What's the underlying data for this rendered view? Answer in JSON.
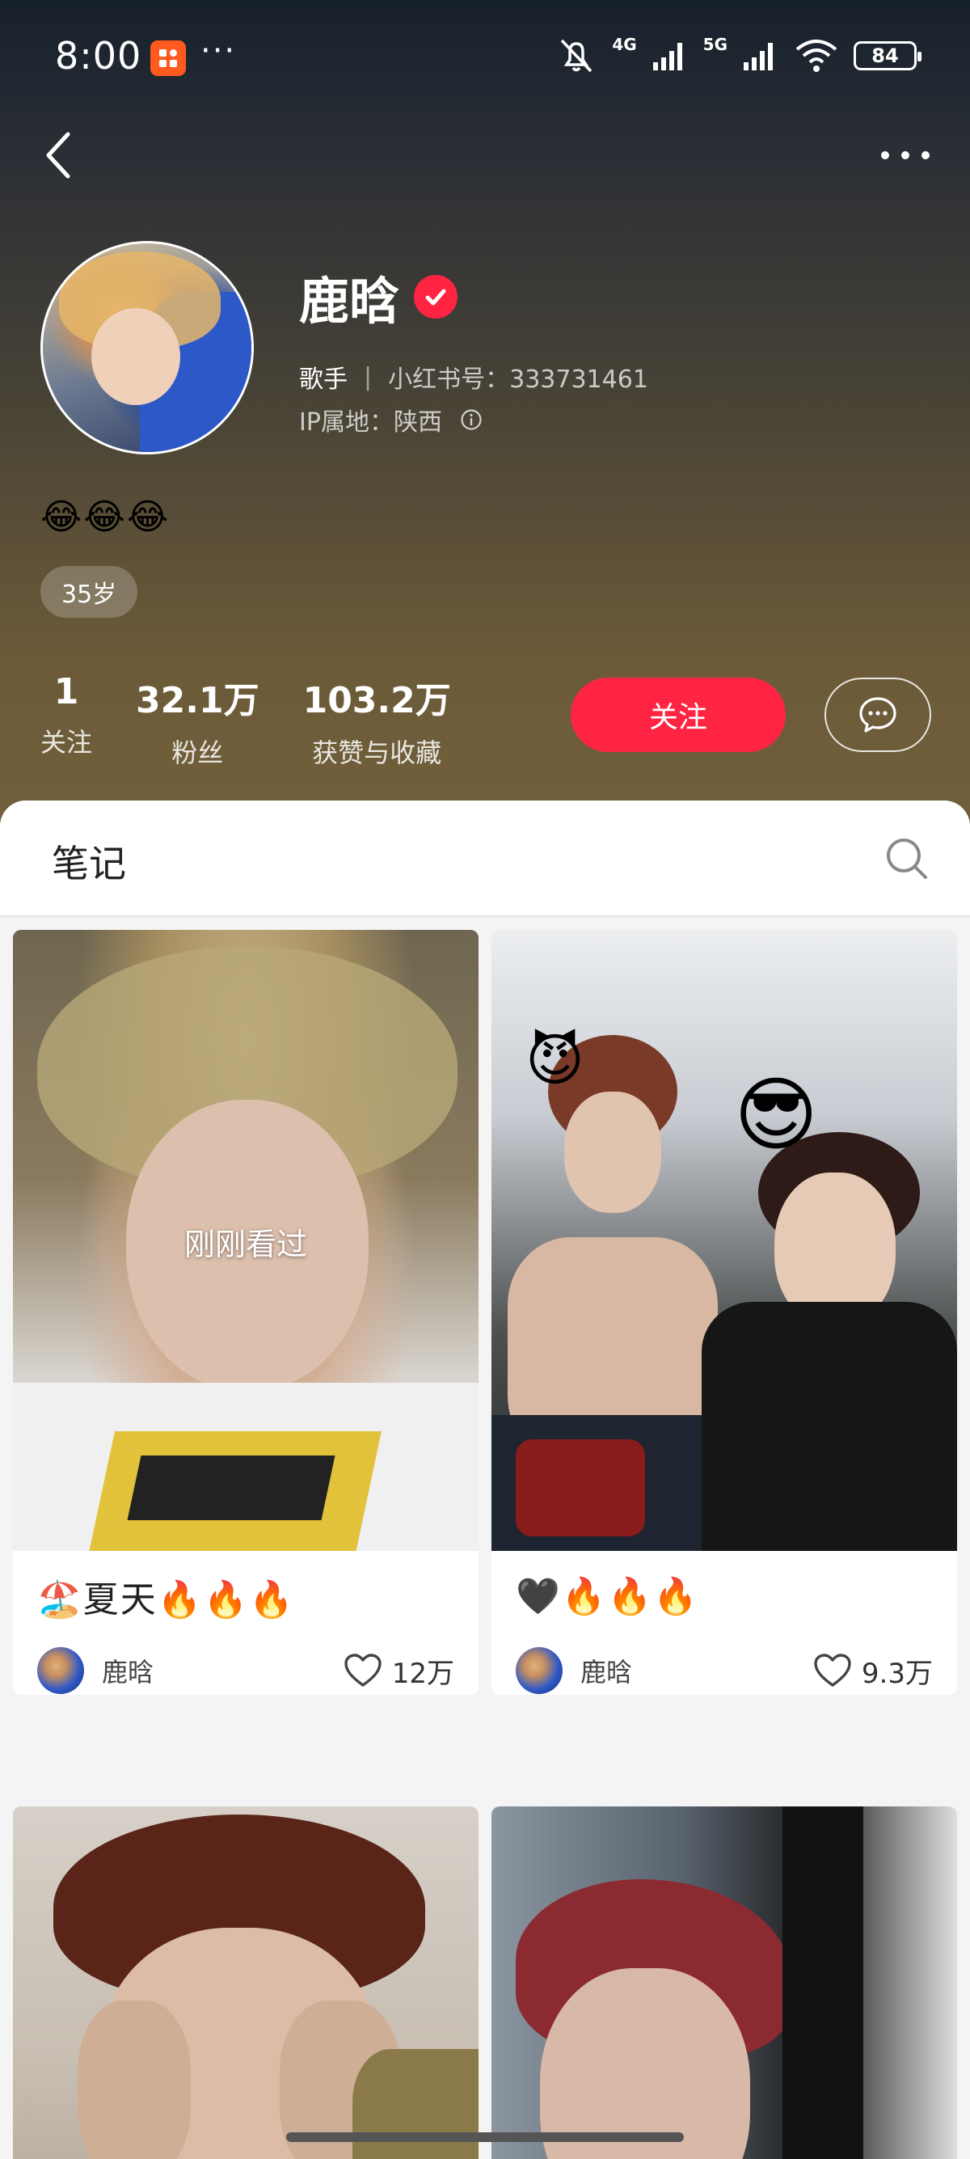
{
  "status_bar": {
    "time": "8:00",
    "more": "···",
    "net_4g": "4G",
    "net_5g": "5G",
    "battery": "84"
  },
  "profile": {
    "name": "鹿晗",
    "role": "歌手",
    "id_label": "小红书号：333731461",
    "ip_label": "IP属地：陕西",
    "bio": "😂😂😂",
    "age_tag": "35岁"
  },
  "stats": [
    {
      "value": "1",
      "label": "关注"
    },
    {
      "value": "32.1万",
      "label": "粉丝"
    },
    {
      "value": "103.2万",
      "label": "获赞与收藏"
    }
  ],
  "actions": {
    "follow_label": "关注"
  },
  "tabs": {
    "notes_label": "笔记"
  },
  "notes": [
    {
      "title": "🏖️夏天🔥🔥🔥",
      "author": "鹿晗",
      "likes": "12万",
      "overlay": "刚刚看过"
    },
    {
      "title": "🖤🔥🔥🔥",
      "author": "鹿晗",
      "likes": "9.3万",
      "emoji_1": "😈",
      "emoji_2": "😎"
    },
    {},
    {}
  ],
  "colors": {
    "accent": "#ff2442",
    "header_top": "#16202c",
    "header_bottom": "#72603c"
  },
  "icons": [
    "back-icon",
    "more-icon",
    "verified-icon",
    "info-icon",
    "message-icon",
    "search-icon",
    "heart-icon"
  ]
}
